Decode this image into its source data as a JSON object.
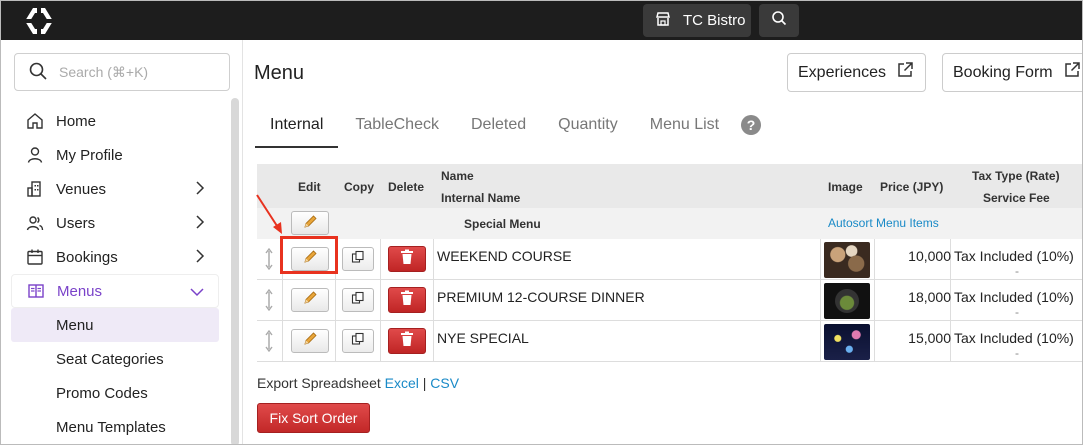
{
  "topbar": {
    "venue_label": "TC Bistro"
  },
  "sidebar": {
    "search_placeholder": "Search (⌘+K)",
    "items": [
      {
        "label": "Home",
        "icon": "home-icon"
      },
      {
        "label": "My Profile",
        "icon": "user-icon"
      },
      {
        "label": "Venues",
        "icon": "building-icon"
      },
      {
        "label": "Users",
        "icon": "users-icon"
      },
      {
        "label": "Bookings",
        "icon": "calendar-icon"
      },
      {
        "label": "Menus",
        "icon": "menu-book-icon"
      }
    ],
    "sub_items": [
      "Menu",
      "Seat Categories",
      "Promo Codes",
      "Menu Templates"
    ]
  },
  "main": {
    "title": "Menu",
    "experiences_label": "Experiences",
    "booking_form_label": "Booking Form",
    "tabs": [
      "Internal",
      "TableCheck",
      "Deleted",
      "Quantity",
      "Menu List"
    ],
    "help_label": "?"
  },
  "table": {
    "headers": {
      "edit": "Edit",
      "copy": "Copy",
      "delete": "Delete",
      "name": "Name",
      "internal_name": "Internal Name",
      "image": "Image",
      "price": "Price (JPY)",
      "tax_type": "Tax Type (Rate)",
      "service_fee": "Service Fee"
    },
    "group_label": "Special Menu",
    "autosort_label": "Autosort Menu Items",
    "rows": [
      {
        "name": "WEEKEND COURSE",
        "price": "10,000",
        "tax": "Tax Included (10%)",
        "fee": "-"
      },
      {
        "name": "PREMIUM 12-COURSE DINNER",
        "price": "18,000",
        "tax": "Tax Included (10%)",
        "fee": "-"
      },
      {
        "name": "NYE SPECIAL",
        "price": "15,000",
        "tax": "Tax Included (10%)",
        "fee": "-"
      }
    ]
  },
  "footer": {
    "export_label": "Export Spreadsheet",
    "excel_label": "Excel",
    "separator": "|",
    "csv_label": "CSV",
    "fix_sort_label": "Fix Sort Order"
  },
  "colors": {
    "accent": "#7a42c9",
    "danger": "#c92a2a",
    "link": "#1a8ac7",
    "highlight": "#e8321f"
  }
}
